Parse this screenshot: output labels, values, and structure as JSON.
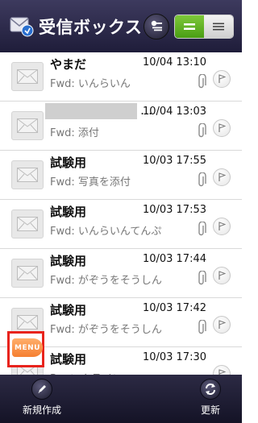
{
  "header": {
    "title": "受信ボックス",
    "app_icon": "mail-inbox-icon",
    "filter_icon": "filter-icon",
    "view_toggle": {
      "active": "list",
      "options": [
        "list",
        "detail"
      ]
    }
  },
  "messages": [
    {
      "sender": "やまだ",
      "date": "10/04 13:10",
      "subject": "Fwd: いんらいん",
      "attachment": true,
      "sender_hidden": false
    },
    {
      "sender": "…",
      "date": "10/04 13:03",
      "subject": "Fwd: 添付",
      "attachment": true,
      "sender_hidden": true
    },
    {
      "sender": "試験用",
      "date": "10/03 17:55",
      "subject": "Fwd: 写真を添付",
      "attachment": true,
      "sender_hidden": false
    },
    {
      "sender": "試験用",
      "date": "10/03 17:53",
      "subject": "Fwd: いんらいんてんぷ",
      "attachment": true,
      "sender_hidden": false
    },
    {
      "sender": "試験用",
      "date": "10/03 17:44",
      "subject": "Fwd: がぞうをそうしん",
      "attachment": true,
      "sender_hidden": false
    },
    {
      "sender": "試験用",
      "date": "10/03 17:42",
      "subject": "Fwd: がぞうをそうしん",
      "attachment": true,
      "sender_hidden": false
    },
    {
      "sender": "試験用",
      "date": "10/03 17:30",
      "subject": "Re: いんライン",
      "attachment": false,
      "sender_hidden": false
    }
  ],
  "menu_tab": {
    "label": "MENU"
  },
  "toolbar": {
    "compose_label": "新規作成",
    "refresh_label": "更新"
  },
  "colors": {
    "header_bg": "#2d2b4a",
    "toggle_active": "#5cb021",
    "menu_orange": "#f57f31",
    "highlight_border": "#e8231c"
  }
}
